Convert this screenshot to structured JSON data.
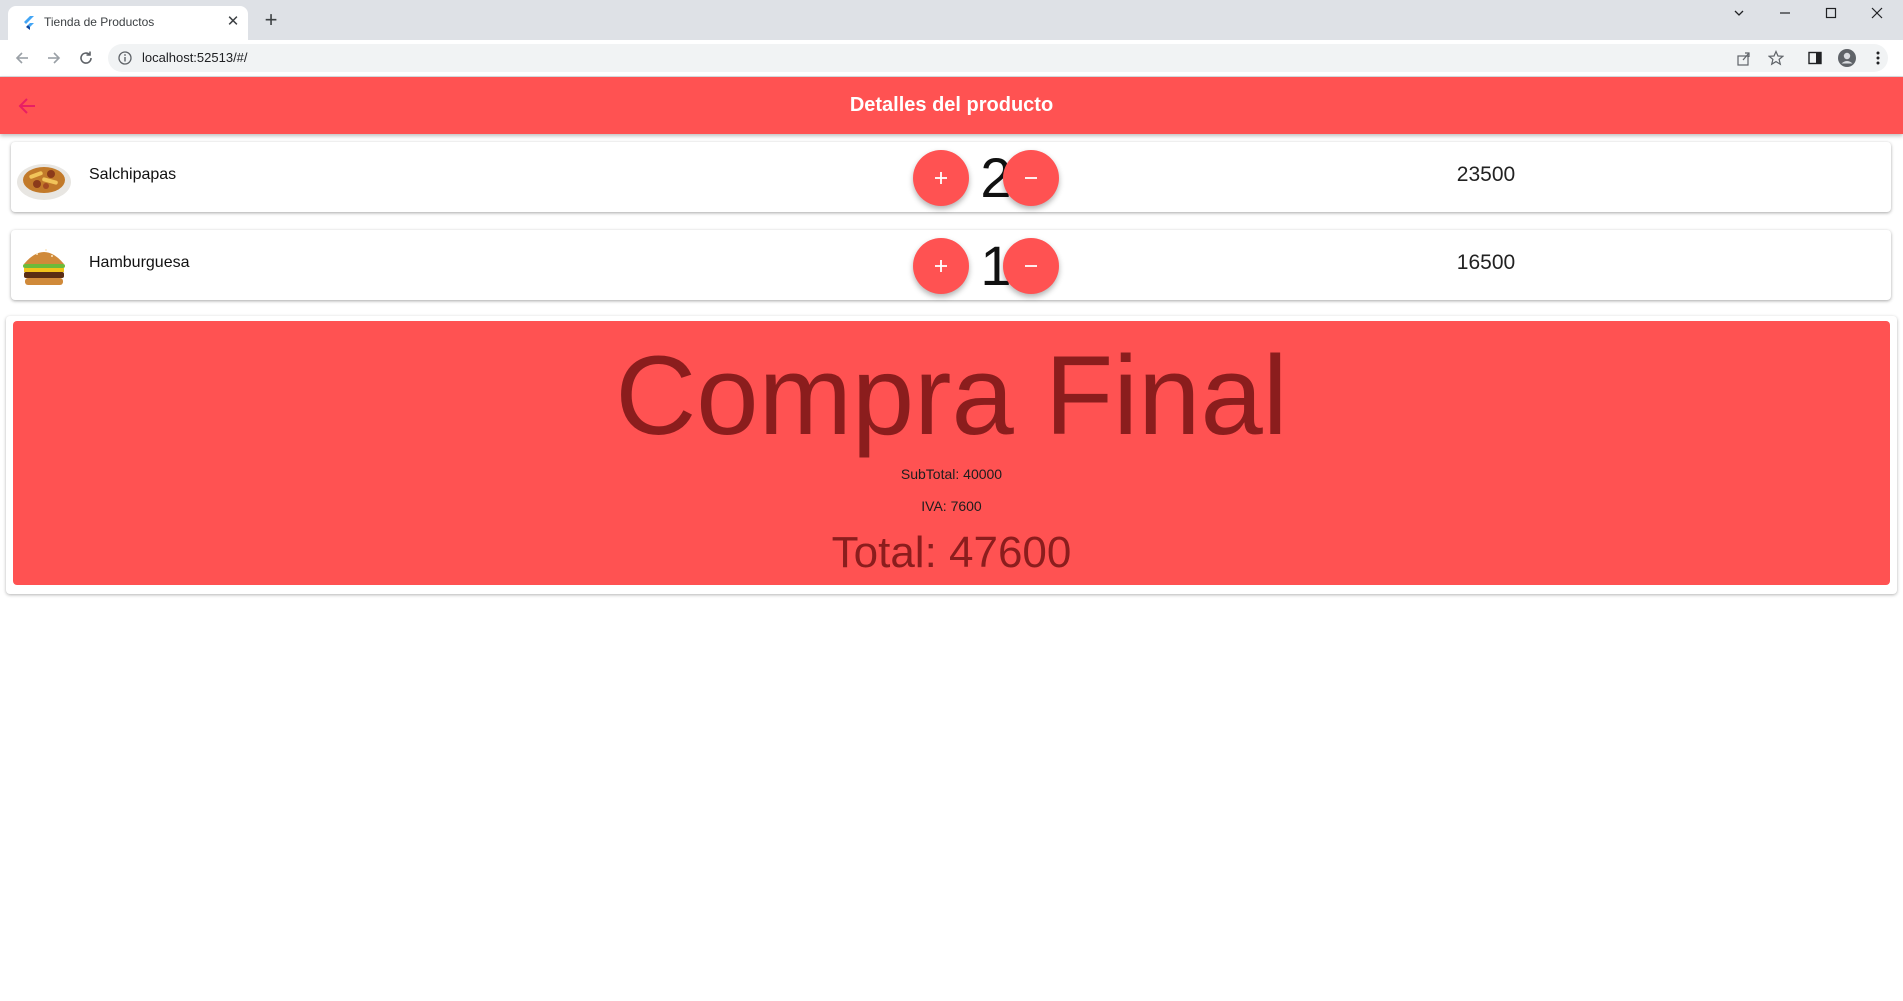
{
  "browser": {
    "tab_title": "Tienda de Productos",
    "tab_close": "✕",
    "new_tab": "+",
    "url": "localhost:52513/#/"
  },
  "appbar": {
    "title": "Detalles del producto",
    "back_icon": "arrow-left-icon"
  },
  "colors": {
    "accent": "#ff5252",
    "summary_text": "#8b1d1d"
  },
  "items": [
    {
      "name": "Salchipapas",
      "quantity": "2",
      "price": "23500",
      "add_label": "+",
      "remove_label": "−"
    },
    {
      "name": "Hamburguesa",
      "quantity": "1",
      "price": "16500",
      "add_label": "+",
      "remove_label": "−"
    }
  ],
  "summary": {
    "title": "Compra Final",
    "subtotal": "SubTotal: 40000",
    "iva": "IVA: 7600",
    "total": "Total: 47600"
  }
}
